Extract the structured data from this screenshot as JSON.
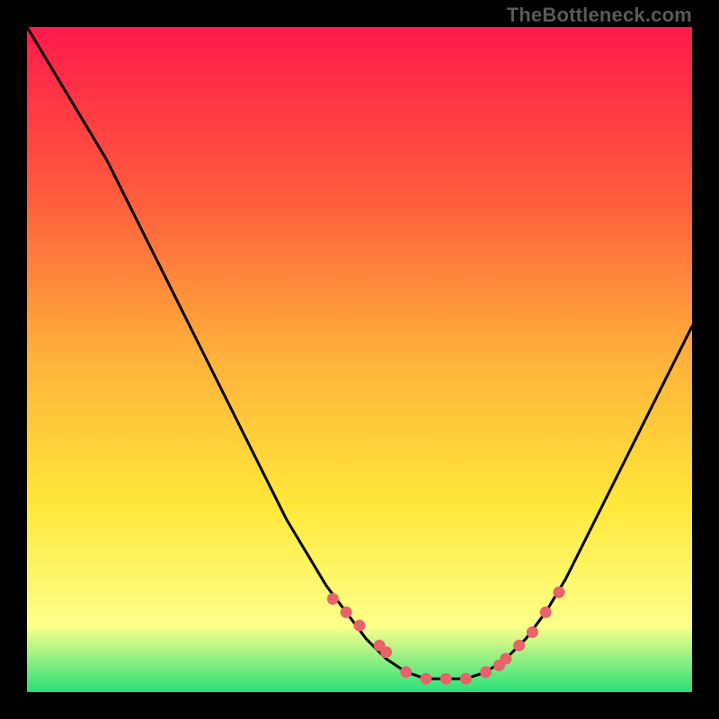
{
  "attribution": "TheBottleneck.com",
  "colors": {
    "background": "#000000",
    "grad_top": "#ff1a4b",
    "grad_mid1": "#ff5a3d",
    "grad_mid2": "#ffb23a",
    "grad_mid3": "#ffe83a",
    "grad_bottom_yellow": "#fdff8a",
    "grad_bottom_green": "#29e07a",
    "curve": "#000000",
    "dots": "#e8636a"
  },
  "chart_data": {
    "type": "line",
    "title": "",
    "xlabel": "",
    "ylabel": "",
    "axes_visible": false,
    "xlim": [
      0,
      100
    ],
    "ylim": [
      0,
      100
    ],
    "plot_background": "vertical-gradient",
    "series": [
      {
        "name": "bottleneck-curve",
        "x": [
          0,
          3,
          6,
          9,
          12,
          15,
          18,
          21,
          24,
          27,
          30,
          33,
          36,
          39,
          42,
          45,
          48,
          51,
          54,
          57,
          60,
          63,
          66,
          69,
          72,
          75,
          78,
          81,
          84,
          87,
          90,
          93,
          96,
          100
        ],
        "y": [
          100,
          95,
          90,
          85,
          80,
          74,
          68,
          62,
          56,
          50,
          44,
          38,
          32,
          26,
          21,
          16,
          12,
          8,
          5,
          3,
          2,
          2,
          2,
          3,
          5,
          8,
          12,
          17,
          23,
          29,
          35,
          41,
          47,
          55
        ]
      }
    ],
    "markers": [
      {
        "name": "fit-dots",
        "x": [
          46,
          48,
          50,
          53,
          54,
          57,
          60,
          63,
          66,
          69,
          71,
          72,
          74,
          76,
          78,
          80
        ],
        "y": [
          14,
          12,
          10,
          7,
          6,
          3,
          2,
          2,
          2,
          3,
          4,
          5,
          7,
          9,
          12,
          15
        ]
      }
    ]
  }
}
